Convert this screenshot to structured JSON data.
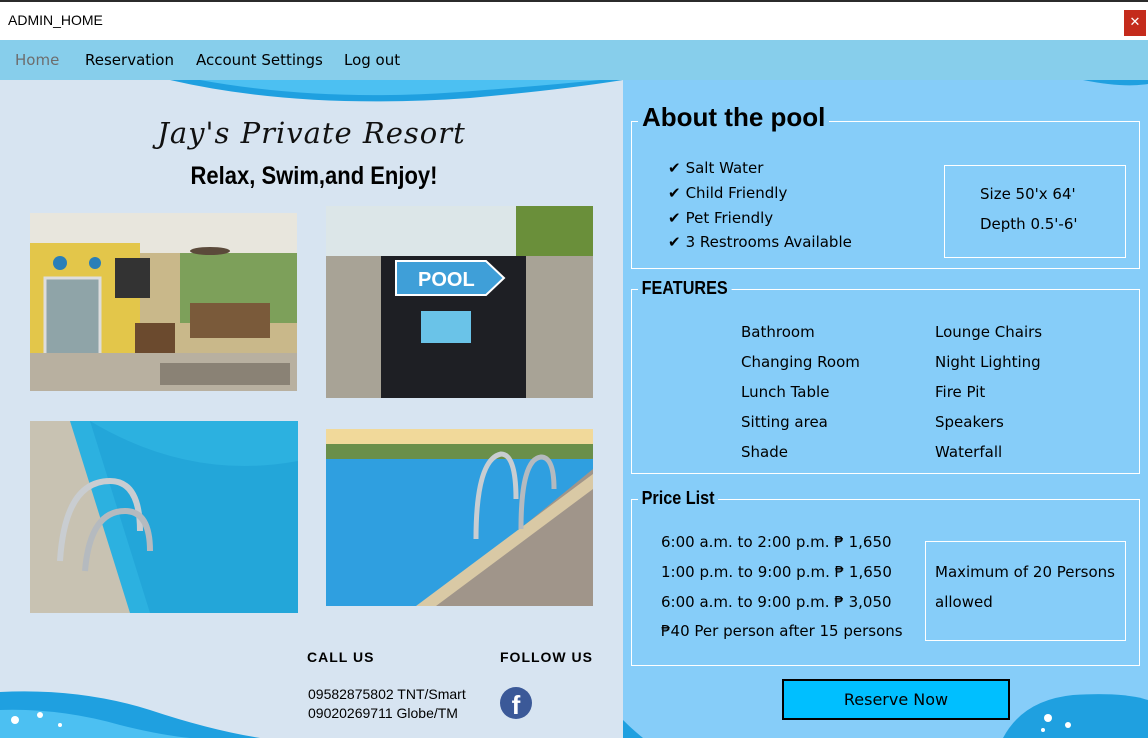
{
  "window": {
    "title": "ADMIN_HOME",
    "close_glyph": "✕"
  },
  "menu": {
    "home": "Home",
    "reservation": "Reservation",
    "account_settings": "Account Settings",
    "logout": "Log out"
  },
  "left": {
    "title": "Jay's Private Resort",
    "subtitle": "Relax, Swim,and Enjoy!",
    "call_us": "CALL US",
    "follow_us": "FOLLOW US",
    "phone_1": "09582875802 TNT/Smart",
    "phone_2": "09020269711 Globe/TM",
    "facebook_glyph": "f",
    "sign_text": "POOL"
  },
  "about": {
    "title": "About the pool",
    "checks": [
      "Salt Water",
      "Child Friendly",
      "Pet Friendly",
      "3 Restrooms Available"
    ],
    "check_glyph": "✔",
    "size": "Size 50'x 64'",
    "depth": "Depth 0.5'-6'"
  },
  "features": {
    "title": "FEATURES",
    "col1": [
      "Bathroom",
      "Changing Room",
      "Lunch Table",
      "Sitting area",
      "Shade"
    ],
    "col2": [
      "Lounge Chairs",
      "Night Lighting",
      "Fire Pit",
      "Speakers",
      "Waterfall"
    ]
  },
  "prices": {
    "title": "Price List",
    "lines": [
      "6:00 a.m. to 2:00 p.m. ₱ 1,650",
      "1:00 p.m. to 9:00 p.m. ₱ 1,650",
      "6:00 a.m. to 9:00 p.m. ₱ 3,050",
      "₱40 Per person after 15 persons"
    ],
    "max_line1": "Maximum of 20 Persons",
    "max_line2": "allowed"
  },
  "reserve_button": "Reserve Now",
  "colors": {
    "menubar": "#87ceeb",
    "left_bg": "#d7e4f1",
    "right_bg": "#86cdf9",
    "button": "#00bfff",
    "close": "#c42b1c",
    "wave": "#1fa0e0"
  },
  "icons": [
    "close-icon",
    "check-icon",
    "facebook-icon"
  ]
}
